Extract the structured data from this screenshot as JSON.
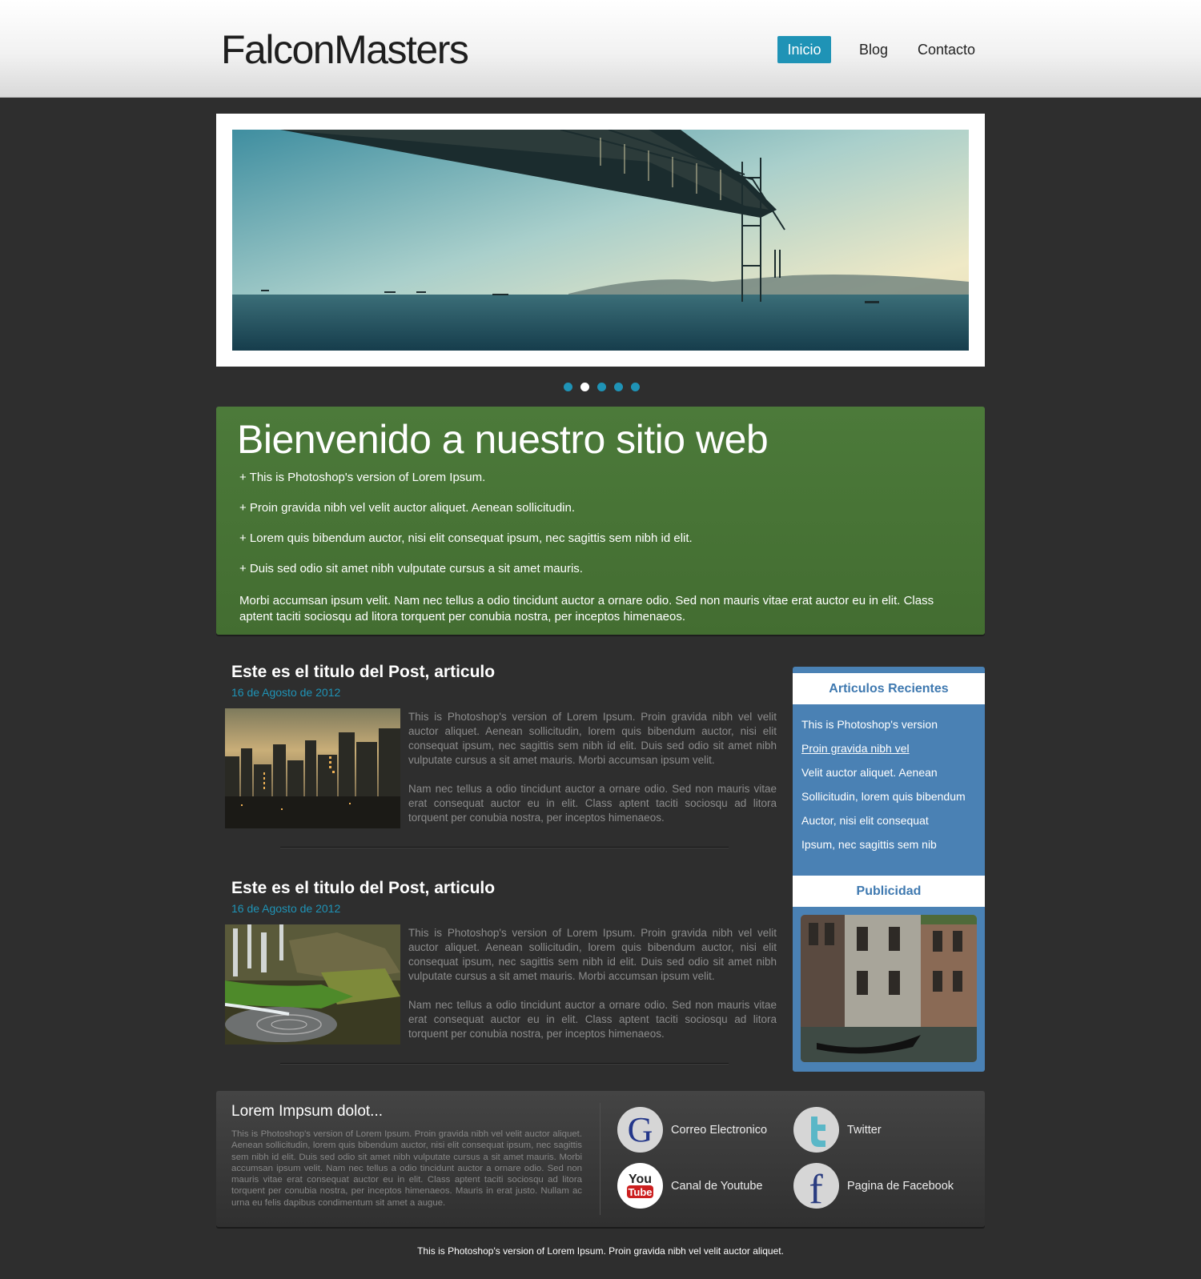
{
  "header": {
    "logo": "FalconMasters",
    "nav": [
      "Inicio",
      "Blog",
      "Contacto"
    ]
  },
  "colors": {
    "accent": "#1f93b6",
    "welcome_bg": "#4a7838",
    "sidebar_bg": "#4a81b4",
    "page_bg": "#2e2e2e"
  },
  "slider": {
    "dots": 5,
    "active_dot": 2
  },
  "welcome": {
    "title": "Bienvenido a nuestro sitio web",
    "items": [
      "+ This is Photoshop's version  of Lorem Ipsum.",
      "+ Proin gravida nibh vel velit auctor aliquet. Aenean sollicitudin.",
      "+ Lorem quis bibendum auctor, nisi elit consequat ipsum, nec sagittis sem nibh id elit.",
      "+ Duis sed odio sit amet nibh vulputate cursus a sit amet mauris."
    ],
    "paragraph": "Morbi accumsan ipsum velit. Nam nec tellus a odio tincidunt auctor a ornare odio. Sed non  mauris vitae erat auctor eu in elit. Class aptent taciti sociosqu ad litora torquent per conubia nostra, per inceptos himenaeos."
  },
  "posts": [
    {
      "title": "Este es el titulo del Post, articulo",
      "date": "16 de Agosto de 2012",
      "p1": "This is Photoshop's version  of Lorem Ipsum. Proin gravida nibh vel velit auctor aliquet. Aenean sollicitudin, lorem quis bibendum auctor, nisi elit consequat ipsum, nec sagittis sem nibh id elit. Duis sed odio sit amet nibh vulputate cursus a sit amet mauris. Morbi accumsan ipsum velit.",
      "p2": "Nam nec tellus a odio tincidunt auctor a ornare odio. Sed non  mauris vitae erat consequat auctor eu in elit. Class aptent taciti sociosqu ad litora torquent per conubia nostra, per inceptos himenaeos."
    },
    {
      "title": "Este es el titulo del Post, articulo",
      "date": "16 de Agosto de 2012",
      "p1": "This is Photoshop's version  of Lorem Ipsum. Proin gravida nibh vel velit auctor aliquet. Aenean sollicitudin, lorem quis bibendum auctor, nisi elit consequat ipsum, nec sagittis sem nibh id elit. Duis sed odio sit amet nibh vulputate cursus a sit amet mauris. Morbi accumsan ipsum velit.",
      "p2": "Nam nec tellus a odio tincidunt auctor a ornare odio. Sed non  mauris vitae erat consequat auctor eu in elit. Class aptent taciti sociosqu ad litora torquent per conubia nostra, per inceptos himenaeos."
    }
  ],
  "sidebar": {
    "recent_title": "Articulos Recientes",
    "recent": [
      "This is Photoshop's version",
      "Proin gravida nibh vel",
      "Velit auctor aliquet. Aenean",
      "Sollicitudin, lorem quis bibendum",
      "Auctor, nisi elit consequat",
      "Ipsum, nec sagittis sem nib"
    ],
    "ad_title": "Publicidad"
  },
  "footer": {
    "title": "Lorem Impsum dolot...",
    "text": "This is Photoshop's version  of Lorem Ipsum. Proin gravida nibh vel velit auctor aliquet. Aenean sollicitudin, lorem quis bibendum auctor, nisi elit consequat ipsum, nec sagittis sem nibh id elit. Duis sed odio sit amet nibh vulputate cursus a sit amet mauris. Morbi accumsan ipsum velit. Nam nec tellus a odio tincidunt auctor a ornare odio. Sed non  mauris vitae erat consequat auctor eu in elit. Class aptent taciti sociosqu ad litora torquent per conubia nostra, per inceptos himenaeos. Mauris in erat justo. Nullam ac urna eu felis dapibus condimentum sit amet a augue.",
    "social": [
      {
        "label": "Correo Electronico",
        "icon": "google-icon"
      },
      {
        "label": "Twitter",
        "icon": "twitter-icon"
      },
      {
        "label": "Canal de Youtube",
        "icon": "youtube-icon"
      },
      {
        "label": "Pagina de Facebook",
        "icon": "facebook-icon"
      }
    ],
    "youtube_text": [
      "You",
      "Tube"
    ],
    "copyright": "This is Photoshop's version  of Lorem Ipsum. Proin gravida nibh vel velit auctor aliquet."
  }
}
